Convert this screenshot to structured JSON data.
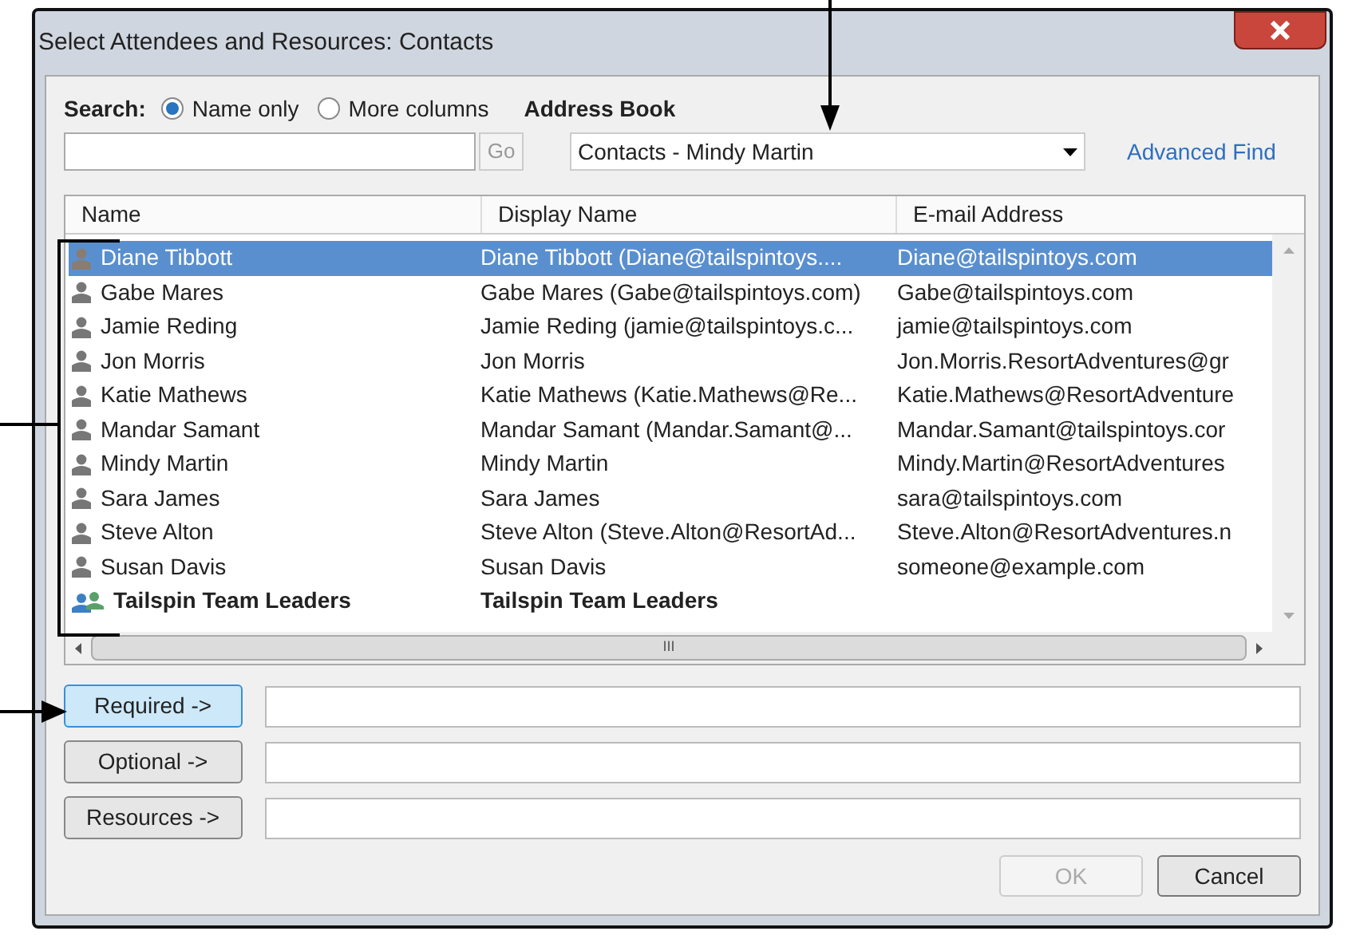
{
  "window": {
    "title": "Select Attendees and Resources: Contacts"
  },
  "search": {
    "label": "Search:",
    "options": [
      {
        "label": "Name only",
        "selected": true
      },
      {
        "label": "More columns",
        "selected": false
      }
    ],
    "go": "Go"
  },
  "address_book": {
    "label": "Address Book",
    "value": "Contacts - Mindy Martin",
    "advanced_find": "Advanced Find"
  },
  "table": {
    "columns": [
      "Name",
      "Display Name",
      "E-mail Address"
    ],
    "rows": [
      {
        "kind": "person",
        "selected": true,
        "cells": [
          "Diane Tibbott",
          "Diane Tibbott (Diane@tailspintoys....",
          "Diane@tailspintoys.com"
        ]
      },
      {
        "kind": "person",
        "selected": false,
        "cells": [
          "Gabe Mares",
          "Gabe Mares (Gabe@tailspintoys.com)",
          "Gabe@tailspintoys.com"
        ]
      },
      {
        "kind": "person",
        "selected": false,
        "cells": [
          "Jamie Reding",
          "Jamie Reding (jamie@tailspintoys.c...",
          "jamie@tailspintoys.com"
        ]
      },
      {
        "kind": "person",
        "selected": false,
        "cells": [
          "Jon Morris",
          "Jon Morris",
          "Jon.Morris.ResortAdventures@gr"
        ]
      },
      {
        "kind": "person",
        "selected": false,
        "cells": [
          "Katie Mathews",
          "Katie Mathews (Katie.Mathews@Re...",
          "Katie.Mathews@ResortAdventure"
        ]
      },
      {
        "kind": "person",
        "selected": false,
        "cells": [
          "Mandar Samant",
          "Mandar Samant (Mandar.Samant@...",
          "Mandar.Samant@tailspintoys.cor"
        ]
      },
      {
        "kind": "person",
        "selected": false,
        "cells": [
          "Mindy Martin",
          "Mindy Martin",
          "Mindy.Martin@ResortAdventures"
        ]
      },
      {
        "kind": "person",
        "selected": false,
        "cells": [
          "Sara James",
          "Sara James",
          "sara@tailspintoys.com"
        ]
      },
      {
        "kind": "person",
        "selected": false,
        "cells": [
          "Steve Alton",
          "Steve Alton (Steve.Alton@ResortAd...",
          "Steve.Alton@ResortAdventures.n"
        ]
      },
      {
        "kind": "person",
        "selected": false,
        "cells": [
          "Susan Davis",
          "Susan Davis",
          "someone@example.com"
        ]
      },
      {
        "kind": "group",
        "selected": false,
        "cells": [
          "Tailspin Team Leaders",
          "Tailspin Team Leaders"
        ]
      }
    ],
    "hscroll": "III"
  },
  "recipients": [
    {
      "button": "Required ->",
      "focused": true
    },
    {
      "button": "Optional ->",
      "focused": false
    },
    {
      "button": "Resources ->",
      "focused": false
    }
  ],
  "buttons": [
    {
      "label": "OK",
      "disabled": true
    },
    {
      "label": "Cancel",
      "disabled": false
    }
  ]
}
